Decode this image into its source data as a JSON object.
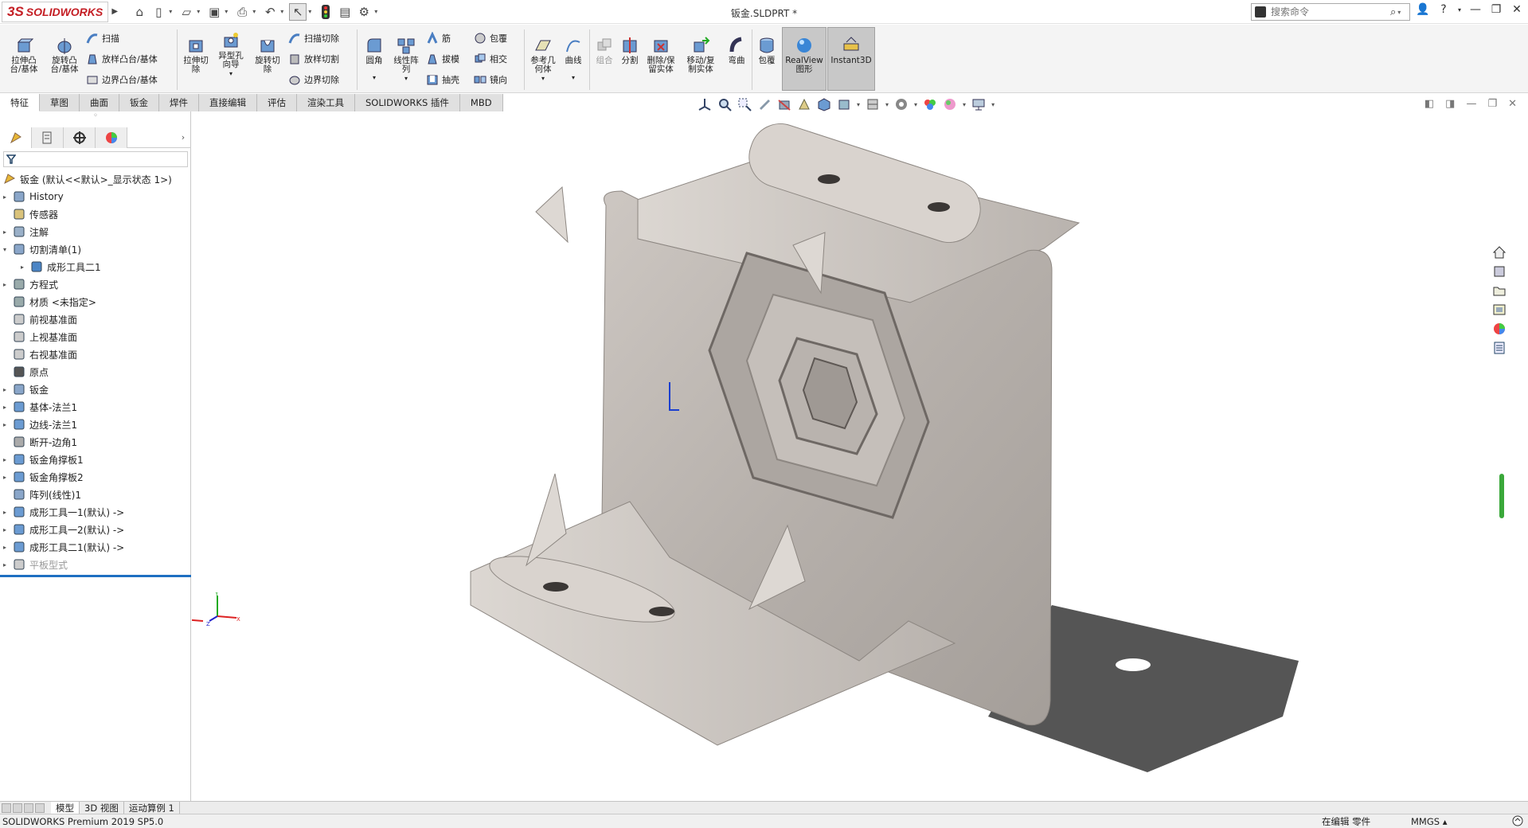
{
  "app": {
    "brand_prefix": "3S",
    "brand_name": "SOLIDWORKS",
    "document_title": "钣金.SLDPRT *",
    "search_placeholder": "搜索命令"
  },
  "ribbon": {
    "col1": [
      {
        "label_line1": "拉伸凸",
        "label_line2": "台/基体"
      },
      {
        "label_line1": "旋转凸",
        "label_line2": "台/基体"
      }
    ],
    "col1_small": [
      "扫描",
      "放样凸台/基体",
      "边界凸台/基体"
    ],
    "col2": [
      {
        "label_line1": "拉伸切",
        "label_line2": "除"
      },
      {
        "label_line1": "异型孔",
        "label_line2": "向导"
      },
      {
        "label_line1": "旋转切",
        "label_line2": "除"
      }
    ],
    "col2_small": [
      "扫描切除",
      "放样切割",
      "边界切除"
    ],
    "col3": [
      {
        "label_line1": "圆角",
        "label_line2": ""
      },
      {
        "label_line1": "线性阵",
        "label_line2": "列"
      }
    ],
    "col3_small": [
      "筋",
      "拔模",
      "抽壳"
    ],
    "col3b_small": [
      "包覆",
      "相交",
      "镜向"
    ],
    "col4": [
      {
        "label_line1": "参考几",
        "label_line2": "何体"
      },
      {
        "label_line1": "曲线",
        "label_line2": ""
      }
    ],
    "col5": [
      {
        "label_line1": "组合",
        "label_line2": ""
      },
      {
        "label_line1": "分割",
        "label_line2": ""
      },
      {
        "label_line1": "删除/保",
        "label_line2": "留实体"
      },
      {
        "label_line1": "移动/复",
        "label_line2": "制实体"
      },
      {
        "label_line1": "弯曲",
        "label_line2": ""
      }
    ],
    "col6": [
      {
        "label_line1": "包覆",
        "label_line2": ""
      },
      {
        "label_line1": "RealView",
        "label_line2": "图形"
      },
      {
        "label_line1": "Instant3D",
        "label_line2": ""
      }
    ]
  },
  "tabs": [
    "特征",
    "草图",
    "曲面",
    "钣金",
    "焊件",
    "直接编辑",
    "评估",
    "渲染工具",
    "SOLIDWORKS 插件",
    "MBD"
  ],
  "tree": {
    "root": "钣金 (默认<<默认>_显示状态 1>)",
    "items": [
      {
        "label": "History",
        "toggle": "▸"
      },
      {
        "label": "传感器",
        "toggle": ""
      },
      {
        "label": "注解",
        "toggle": "▸"
      },
      {
        "label": "切割清单(1)",
        "toggle": "▾"
      },
      {
        "label": "成形工具二1",
        "toggle": "▸",
        "indent": 1
      },
      {
        "label": "方程式",
        "toggle": "▸"
      },
      {
        "label": "材质 <未指定>",
        "toggle": ""
      },
      {
        "label": "前视基准面",
        "toggle": ""
      },
      {
        "label": "上视基准面",
        "toggle": ""
      },
      {
        "label": "右视基准面",
        "toggle": ""
      },
      {
        "label": "原点",
        "toggle": ""
      },
      {
        "label": "钣金",
        "toggle": "▸"
      },
      {
        "label": "基体-法兰1",
        "toggle": "▸"
      },
      {
        "label": "边线-法兰1",
        "toggle": "▸"
      },
      {
        "label": "断开-边角1",
        "toggle": ""
      },
      {
        "label": "钣金角撑板1",
        "toggle": "▸"
      },
      {
        "label": "钣金角撑板2",
        "toggle": "▸"
      },
      {
        "label": "阵列(线性)1",
        "toggle": ""
      },
      {
        "label": "成形工具一1(默认) ->",
        "toggle": "▸"
      },
      {
        "label": "成形工具一2(默认) ->",
        "toggle": "▸"
      },
      {
        "label": "成形工具二1(默认) ->",
        "toggle": "▸"
      },
      {
        "label": "平板型式",
        "toggle": "▸",
        "dim": true
      }
    ]
  },
  "bottom_tabs": [
    "模型",
    "3D 视图",
    "运动算例 1"
  ],
  "status": {
    "product": "SOLIDWORKS Premium 2019 SP5.0",
    "editing": "在编辑 零件",
    "units": "MMGS",
    "units_arrow": "▴"
  },
  "colors": {
    "brand_red": "#c41e24",
    "accent_blue": "#1e6fc2",
    "part_metal": "#b9b3ae"
  }
}
